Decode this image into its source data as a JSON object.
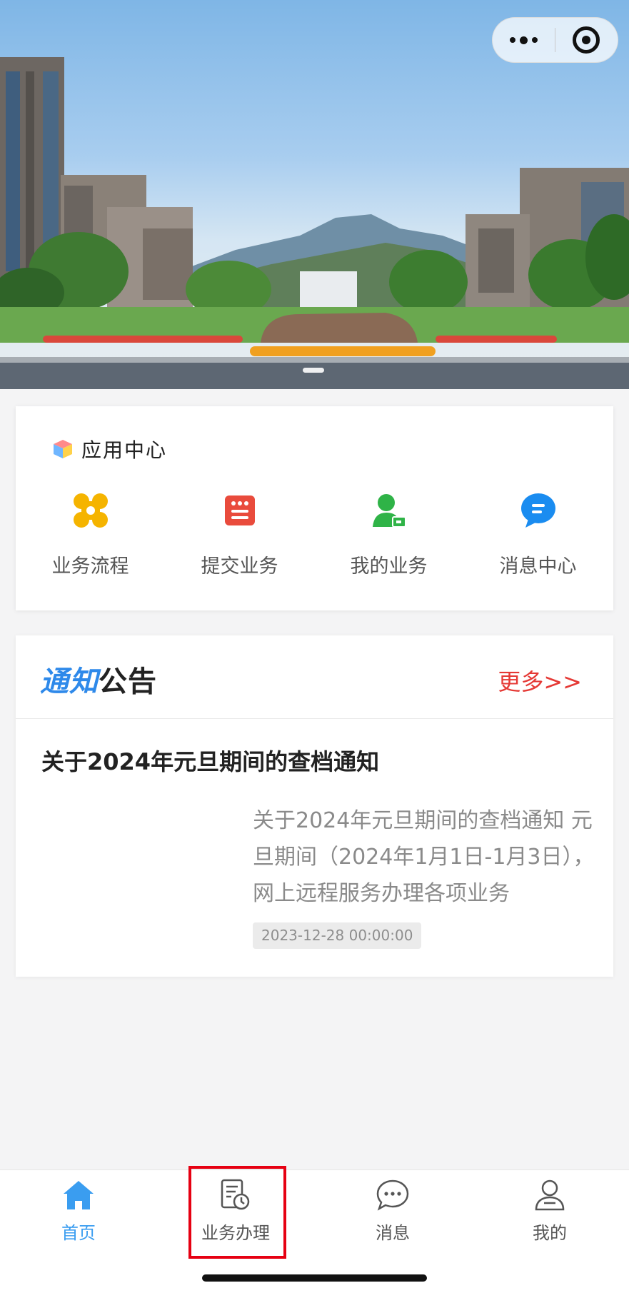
{
  "capsule": {
    "more_icon": "more-dots-icon",
    "close_icon": "record-close-icon"
  },
  "app_center": {
    "title": "应用中心",
    "items": [
      {
        "label": "业务流程",
        "icon": "flow-grid-icon",
        "color": "#f5b400"
      },
      {
        "label": "提交业务",
        "icon": "submit-form-icon",
        "color": "#e94b3c"
      },
      {
        "label": "我的业务",
        "icon": "user-card-icon",
        "color": "#2fb347"
      },
      {
        "label": "消息中心",
        "icon": "chat-bubble-icon",
        "color": "#1a8cf0"
      }
    ]
  },
  "notice": {
    "title_part1": "通知",
    "title_part2": "公告",
    "more_label": "更多>>",
    "article": {
      "title": "关于2024年元旦期间的查档通知",
      "summary": "关于2024年元旦期间的查档通知 元旦期间（2024年1月1日-1月3日），网上远程服务办理各项业务",
      "date": "2023-12-28 00:00:00"
    }
  },
  "tabbar": {
    "active_color": "#3a9df0",
    "items": [
      {
        "label": "首页",
        "icon": "home-icon",
        "active": true
      },
      {
        "label": "业务办理",
        "icon": "business-doc-icon",
        "active": false
      },
      {
        "label": "消息",
        "icon": "message-icon",
        "active": false
      },
      {
        "label": "我的",
        "icon": "profile-icon",
        "active": false
      }
    ]
  }
}
